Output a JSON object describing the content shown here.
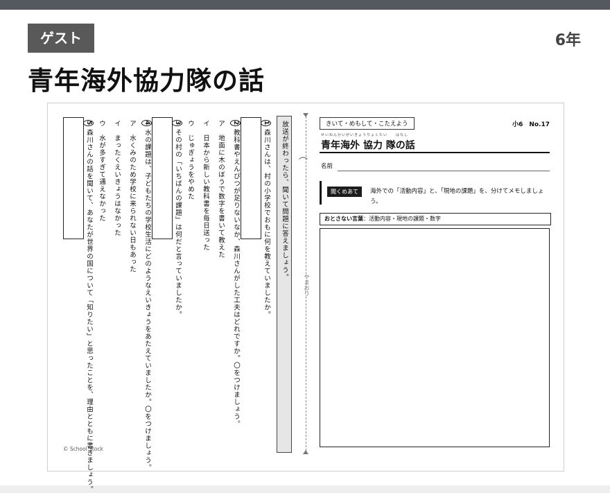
{
  "header": {
    "badge": "ゲスト",
    "grade": "6年",
    "title": "青年海外協力隊の話"
  },
  "worksheet": {
    "instruction": "放送が終わったら、聞いて問題に答えましょう。",
    "fold_label": "やまおり",
    "copyright": "© School Stock",
    "questions": [
      {
        "num": "1",
        "text": "森川さんは、村の小学校でおもに何を教えていましたか。",
        "options": []
      },
      {
        "num": "2",
        "text": "教科書やえんぴつが足りないなか、森川さんがした工夫はどれですか。〇をつけましょう。",
        "options": [
          "ア　地面に木のぼうで数字を書いて教えた",
          "イ　日本から新しい教科書を毎日送った",
          "ウ　じゅぎょうをやめた"
        ]
      },
      {
        "num": "3",
        "text": "その村の「いちばんの課題」は何だと言っていましたか。",
        "options": []
      },
      {
        "num": "4",
        "text": "水の課題は、子どもたちの学校生活にどのようなえいきょうをあたえていましたか。〇をつけましょう。",
        "options": [
          "ア　水くみのため学校に来られない日もあった",
          "イ　まったくえいきょうはなかった",
          "ウ　水が多すぎて通えなかった"
        ]
      },
      {
        "num": "5",
        "text": "森川さんの話を聞いて、あなたが世界の国について「知りたい」と思ったことを、理由とともに書きましょう。",
        "options": []
      }
    ],
    "right": {
      "header_box": "きいて・めもして・こたえよう",
      "number": "小6　No.17",
      "title_ruby": "せいねんかいがいきょうりょくたい　　はなし",
      "title": "青年海外 協力 隊の話",
      "name_label": "名前",
      "task_pill": "聞くめあて",
      "task_text": "海外での「活動内容」と、「現地の課題」を、分けてメモしましょう。",
      "keywords_label": "おとさない言葉",
      "keywords": "：活動内容・現地の課題・数字"
    }
  }
}
